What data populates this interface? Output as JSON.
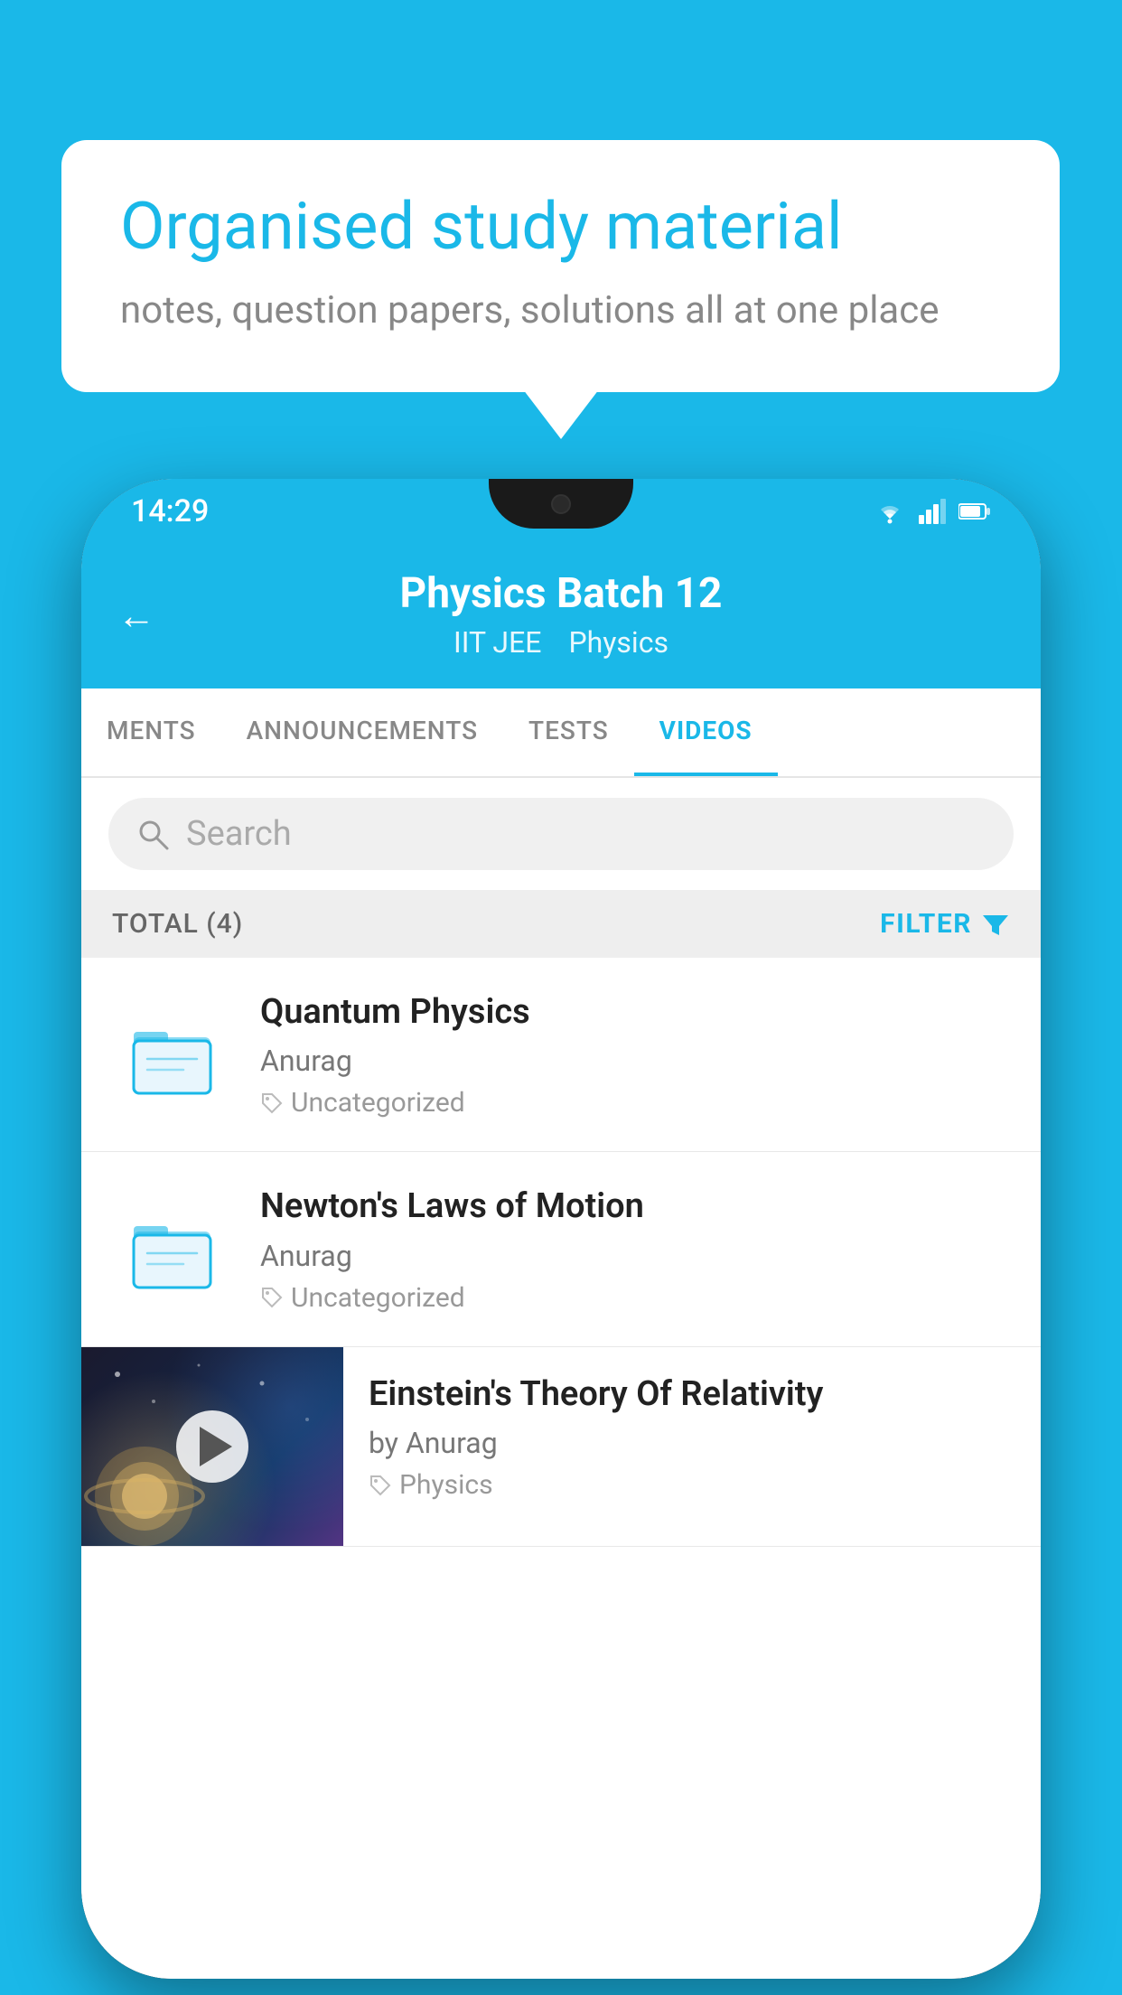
{
  "background": {
    "color": "#1ab8e8"
  },
  "speech_bubble": {
    "heading": "Organised study material",
    "subtext": "notes, question papers, solutions all at one place"
  },
  "phone": {
    "status_bar": {
      "time": "14:29"
    },
    "header": {
      "title": "Physics Batch 12",
      "subtitle1": "IIT JEE",
      "subtitle2": "Physics",
      "back_label": "←"
    },
    "tabs": [
      {
        "label": "MENTS",
        "active": false
      },
      {
        "label": "ANNOUNCEMENTS",
        "active": false
      },
      {
        "label": "TESTS",
        "active": false
      },
      {
        "label": "VIDEOS",
        "active": true
      }
    ],
    "search": {
      "placeholder": "Search"
    },
    "filter_bar": {
      "total": "TOTAL (4)",
      "filter_label": "FILTER"
    },
    "videos": [
      {
        "id": 1,
        "title": "Quantum Physics",
        "author": "Anurag",
        "tag": "Uncategorized",
        "type": "folder"
      },
      {
        "id": 2,
        "title": "Newton's Laws of Motion",
        "author": "Anurag",
        "tag": "Uncategorized",
        "type": "folder"
      },
      {
        "id": 3,
        "title": "Einstein's Theory Of Relativity",
        "author": "by Anurag",
        "tag": "Physics",
        "type": "video"
      }
    ]
  }
}
